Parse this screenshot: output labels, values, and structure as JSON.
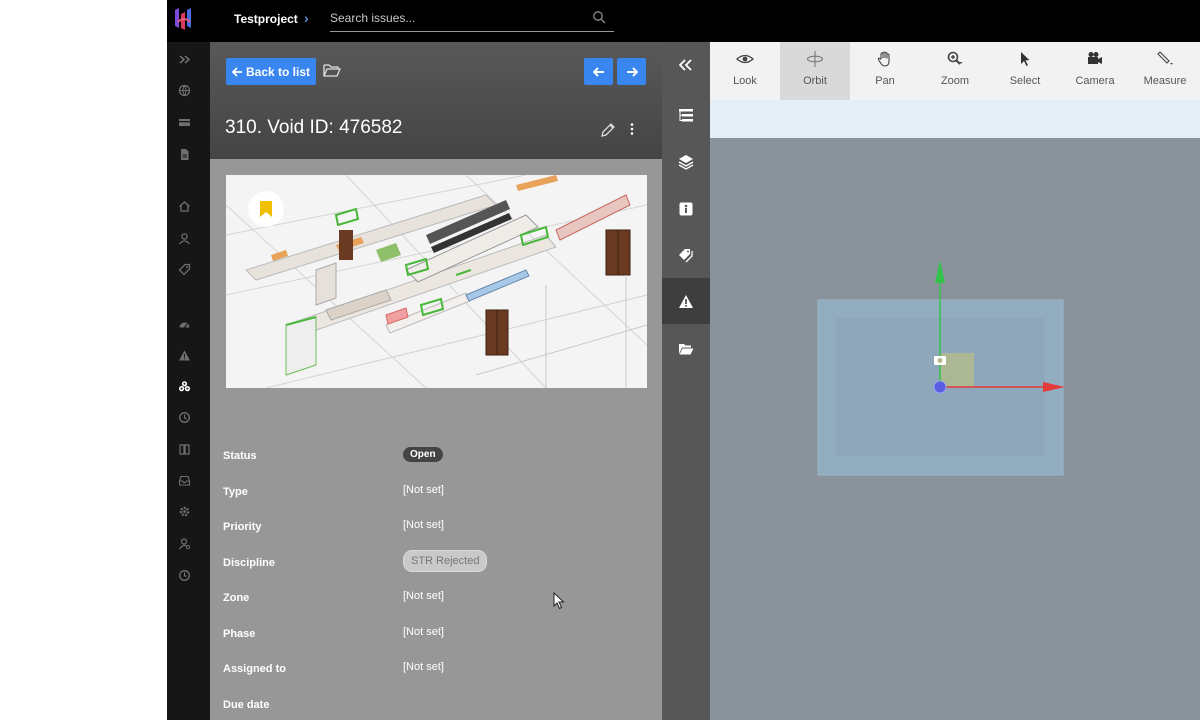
{
  "topbar": {
    "project": "Testproject",
    "search_placeholder": "Search issues..."
  },
  "issue": {
    "back_label": "Back to list",
    "title": "310.  Void ID: 476582",
    "fields": [
      {
        "label": "Status",
        "value": "Open",
        "kind": "status-pill"
      },
      {
        "label": "Type",
        "value": "[Not set]",
        "kind": "text"
      },
      {
        "label": "Priority",
        "value": "[Not set]",
        "kind": "text"
      },
      {
        "label": "Discipline",
        "value": "STR Rejected",
        "kind": "tag-pill"
      },
      {
        "label": "Zone",
        "value": "[Not set]",
        "kind": "text"
      },
      {
        "label": "Phase",
        "value": "[Not set]",
        "kind": "text"
      },
      {
        "label": "Assigned to",
        "value": "[Not set]",
        "kind": "text"
      },
      {
        "label": "Due date",
        "value": "",
        "kind": "text"
      }
    ]
  },
  "viewer": {
    "tools": [
      {
        "label": "Look",
        "icon": "eye-icon"
      },
      {
        "label": "Orbit",
        "icon": "orbit-icon"
      },
      {
        "label": "Pan",
        "icon": "hand-icon"
      },
      {
        "label": "Zoom",
        "icon": "zoom-icon"
      },
      {
        "label": "Select",
        "icon": "cursor-icon"
      },
      {
        "label": "Camera",
        "icon": "camera-icon"
      },
      {
        "label": "Measure",
        "icon": "ruler-icon"
      }
    ],
    "active_tool": "Orbit"
  },
  "colors": {
    "accent": "#3a86f0",
    "panel": "#979797",
    "viewer_bg": "#8a939b",
    "gizmo_x": "#e33b3b",
    "gizmo_y": "#35c24a"
  }
}
